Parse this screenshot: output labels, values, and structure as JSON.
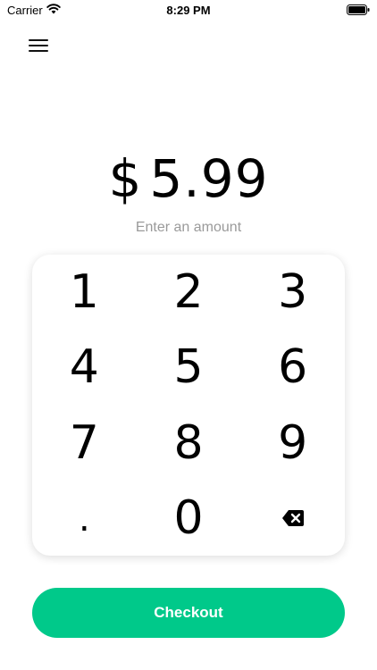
{
  "status_bar": {
    "carrier": "Carrier",
    "time": "8:29 PM"
  },
  "menu": {
    "icon": "hamburger-icon"
  },
  "amount": {
    "currency": "$",
    "value": "5.99"
  },
  "hint": "Enter an amount",
  "keypad": {
    "keys": [
      "1",
      "2",
      "3",
      "4",
      "5",
      "6",
      "7",
      "8",
      "9",
      ".",
      "0"
    ],
    "backspace_icon": "backspace-icon"
  },
  "checkout": {
    "label": "Checkout",
    "color": "#00c98a"
  }
}
